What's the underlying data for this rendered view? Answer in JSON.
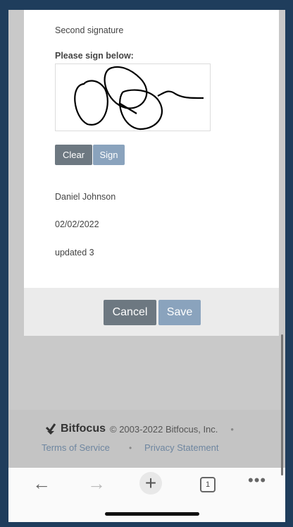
{
  "form": {
    "section_title": "Second signature",
    "sign_prompt": "Please sign below:",
    "clear_label": "Clear",
    "sign_label": "Sign",
    "name_value": "Daniel Johnson",
    "date_value": "02/02/2022",
    "note_value": "updated 3"
  },
  "actions": {
    "cancel_label": "Cancel",
    "save_label": "Save"
  },
  "footer": {
    "brand": "Bitfocus",
    "copyright": "© 2003-2022 Bitfocus, Inc.",
    "separator": "•",
    "terms": "Terms of Service",
    "privacy": "Privacy Statement"
  },
  "browser": {
    "back_icon": "arrow-left-icon",
    "forward_icon": "arrow-right-icon",
    "new_tab_icon": "plus-icon",
    "tab_count": "1",
    "more_icon": "ellipsis-icon"
  },
  "colors": {
    "frame": "#1f3d5c",
    "primary_button": "#8aa3bd",
    "secondary_button": "#6d7881",
    "link": "#6e86a0"
  }
}
